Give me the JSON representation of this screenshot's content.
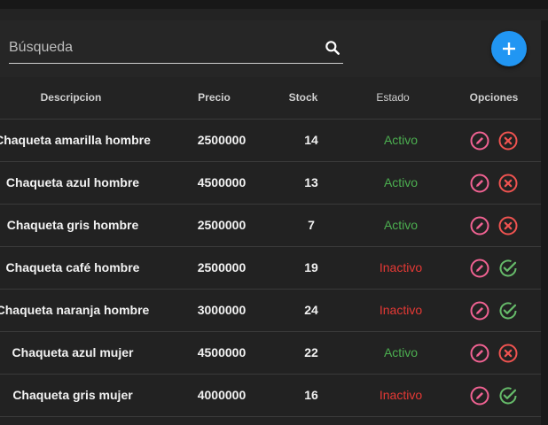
{
  "colors": {
    "accent": "#2196f3",
    "edit": "#f06292",
    "delete": "#ef5350",
    "activate": "#66bb6a",
    "active_text": "#4caf50",
    "inactive_text": "#e53935"
  },
  "search": {
    "placeholder": "Búsqueda",
    "icon": "search-icon"
  },
  "fab": {
    "icon": "plus-icon"
  },
  "table": {
    "headers": [
      "Descripcion",
      "Precio",
      "Stock",
      "Estado",
      "Opciones"
    ],
    "rows": [
      {
        "descripcion": "Chaqueta amarilla hombre",
        "precio": "2500000",
        "stock": "14",
        "estado": "Activo",
        "accion": "delete"
      },
      {
        "descripcion": "Chaqueta azul hombre",
        "precio": "4500000",
        "stock": "13",
        "estado": "Activo",
        "accion": "delete"
      },
      {
        "descripcion": "Chaqueta gris hombre",
        "precio": "2500000",
        "stock": "7",
        "estado": "Activo",
        "accion": "delete"
      },
      {
        "descripcion": "Chaqueta café hombre",
        "precio": "2500000",
        "stock": "19",
        "estado": "Inactivo",
        "accion": "activate"
      },
      {
        "descripcion": "Chaqueta naranja hombre",
        "precio": "3000000",
        "stock": "24",
        "estado": "Inactivo",
        "accion": "activate"
      },
      {
        "descripcion": "Chaqueta azul mujer",
        "precio": "4500000",
        "stock": "22",
        "estado": "Activo",
        "accion": "delete"
      },
      {
        "descripcion": "Chaqueta gris mujer",
        "precio": "4000000",
        "stock": "16",
        "estado": "Inactivo",
        "accion": "activate"
      }
    ]
  }
}
